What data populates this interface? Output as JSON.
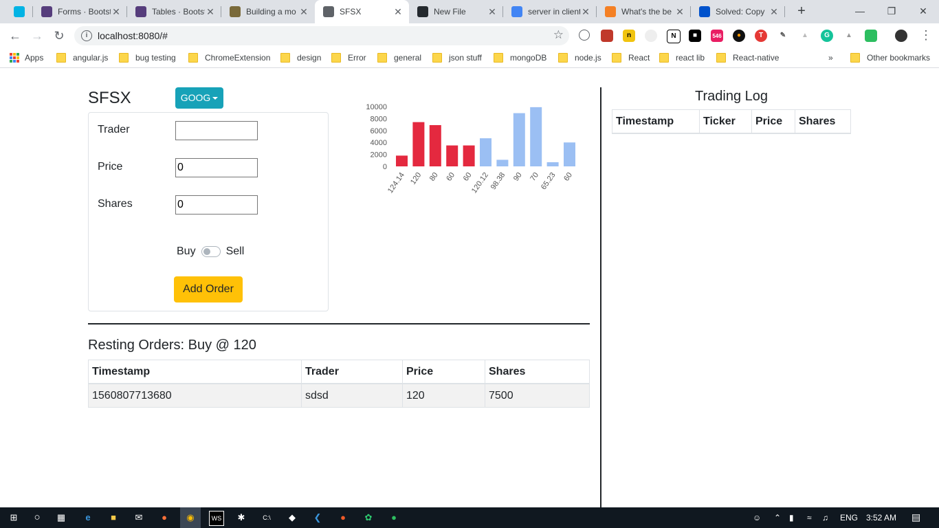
{
  "browser": {
    "tabs": [
      {
        "title": "",
        "favicon": "udacity-icon",
        "color": "#02b3e4"
      },
      {
        "title": "Forms · Bootstrap",
        "favicon": "bootstrap-icon",
        "color": "#563d7c"
      },
      {
        "title": "Tables · Bootstrap",
        "favicon": "bootstrap-icon",
        "color": "#563d7c"
      },
      {
        "title": "Building a mo",
        "favicon": "generic-page-icon",
        "color": "#7a6a3a"
      },
      {
        "title": "SFSX",
        "favicon": "globe-icon",
        "color": "#5f6368"
      },
      {
        "title": "New File",
        "favicon": "github-icon",
        "color": "#24292e"
      },
      {
        "title": "server in client",
        "favicon": "google-icon",
        "color": "#4285f4"
      },
      {
        "title": "What's the be",
        "favicon": "stackoverflow-icon",
        "color": "#f48024"
      },
      {
        "title": "Solved: Copy",
        "favicon": "atlassian-icon",
        "color": "#0052cc"
      }
    ],
    "active_tab_index": 4,
    "new_tab_label": "+",
    "url": "localhost:8080/#",
    "bookmarks": [
      {
        "label": "Apps",
        "type": "apps"
      },
      {
        "label": "angular.js",
        "type": "folder"
      },
      {
        "label": "bug testing",
        "type": "folder"
      },
      {
        "label": "ChromeExtension",
        "type": "folder"
      },
      {
        "label": "design",
        "type": "folder"
      },
      {
        "label": "Error",
        "type": "folder"
      },
      {
        "label": "general",
        "type": "folder"
      },
      {
        "label": "json stuff",
        "type": "folder"
      },
      {
        "label": "mongoDB",
        "type": "folder"
      },
      {
        "label": "node.js",
        "type": "folder"
      },
      {
        "label": "React",
        "type": "folder"
      },
      {
        "label": "react lib",
        "type": "folder"
      },
      {
        "label": "React-native",
        "type": "folder"
      }
    ],
    "more_bookmarks": "»",
    "other_bookmarks": "Other bookmarks",
    "extension_badge": "546"
  },
  "app": {
    "brand": "SFSX",
    "ticker": "GOOG",
    "form": {
      "trader_label": "Trader",
      "trader_value": "",
      "price_label": "Price",
      "price_value": "0",
      "shares_label": "Shares",
      "shares_value": "0",
      "buy_label": "Buy",
      "sell_label": "Sell",
      "add_button": "Add Order"
    },
    "resting": {
      "title": "Resting Orders: Buy @ 120",
      "headers": [
        "Timestamp",
        "Trader",
        "Price",
        "Shares"
      ],
      "rows": [
        [
          "1560807713680",
          "sdsd",
          "120",
          "7500"
        ]
      ]
    },
    "log": {
      "title": "Trading Log",
      "headers": [
        "Timestamp",
        "Ticker",
        "Price",
        "Shares"
      ]
    }
  },
  "chart_data": {
    "type": "bar",
    "categories": [
      "124.14",
      "120",
      "80",
      "60",
      "60",
      "120.12",
      "98.38",
      "90",
      "70",
      "65.23",
      "60"
    ],
    "values": [
      1800,
      7400,
      6900,
      3500,
      3500,
      4700,
      1100,
      8900,
      9900,
      700,
      4000
    ],
    "bar_colors": [
      "#e4293f",
      "#e4293f",
      "#e4293f",
      "#e4293f",
      "#e4293f",
      "#9bbff3",
      "#9bbff3",
      "#9bbff3",
      "#9bbff3",
      "#9bbff3",
      "#9bbff3"
    ],
    "y_ticks": [
      "10000",
      "8000",
      "6000",
      "4000",
      "2000",
      "0"
    ],
    "ylim": [
      0,
      10000
    ]
  },
  "taskbar": {
    "language": "ENG",
    "time": "3:52 AM"
  }
}
